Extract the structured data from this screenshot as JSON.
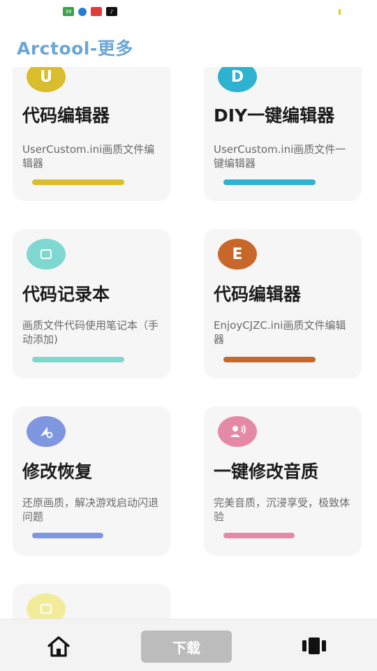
{
  "status_bar": {
    "icons": [
      "app-icon-green",
      "app-icon-blue",
      "app-icon-red",
      "tiktok-icon"
    ],
    "badge_text": "39"
  },
  "header": {
    "title": "Arctool-更多"
  },
  "cards": [
    {
      "icon_letter": "U",
      "title": "代码编辑器",
      "desc": "UserCustom.ini画质文件编辑器",
      "color": "#d9bd2c"
    },
    {
      "icon_letter": "D",
      "title": "DIY一键编辑器",
      "desc": "UserCustom.ini画质文件一键编辑器",
      "color": "#2db2cf"
    },
    {
      "icon_letter": "",
      "title": "代码记录本",
      "desc": "画质文件代码使用笔记本（手动添加)",
      "color": "#7fd8cf"
    },
    {
      "icon_letter": "E",
      "title": "代码编辑器",
      "desc": "EnjoyCJZC.ini画质文件编辑器",
      "color": "#c8672a"
    },
    {
      "icon_letter": "",
      "title": "修改恢复",
      "desc": "还原画质，解决游戏启动闪退问题",
      "color": "#7f96e0"
    },
    {
      "icon_letter": "",
      "title": "一键修改音质",
      "desc": "完美音质，沉浸享受，极致体验",
      "color": "#e58aa6"
    },
    {
      "icon_letter": "",
      "title": "",
      "desc": "",
      "color": "#f2ec9a"
    }
  ],
  "bottom_nav": {
    "center_label": "下载"
  }
}
